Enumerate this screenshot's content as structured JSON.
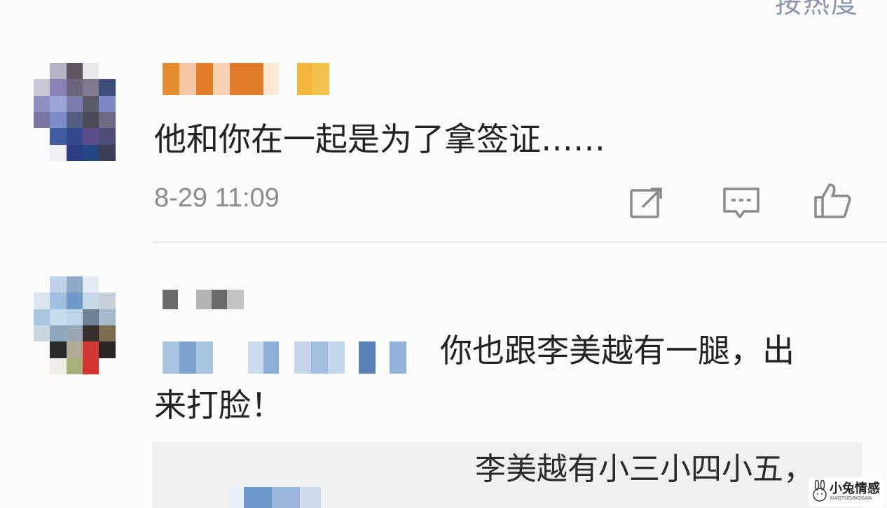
{
  "header": {
    "sort_label": "按热度"
  },
  "comments": [
    {
      "text": "他和你在一起是为了拿签证……",
      "time": "8-29 11:09",
      "avatar_icon": "pixelated-avatar",
      "name_icon": "pixelated-username"
    },
    {
      "text_line1": "你也跟李美越有一腿，出",
      "text_line2": "来打脸！",
      "avatar_icon": "pixelated-avatar",
      "name_icon": "pixelated-username",
      "mention_icon": "pixelated-mentions",
      "reply": {
        "text": "李美越有小三小四小五，"
      }
    }
  ],
  "actions": [
    {
      "icon": "repost-icon"
    },
    {
      "icon": "comment-icon"
    },
    {
      "icon": "like-icon"
    }
  ],
  "watermark": {
    "title": "小兔情感",
    "subtitle": "XIAOTUQINGGAN"
  }
}
